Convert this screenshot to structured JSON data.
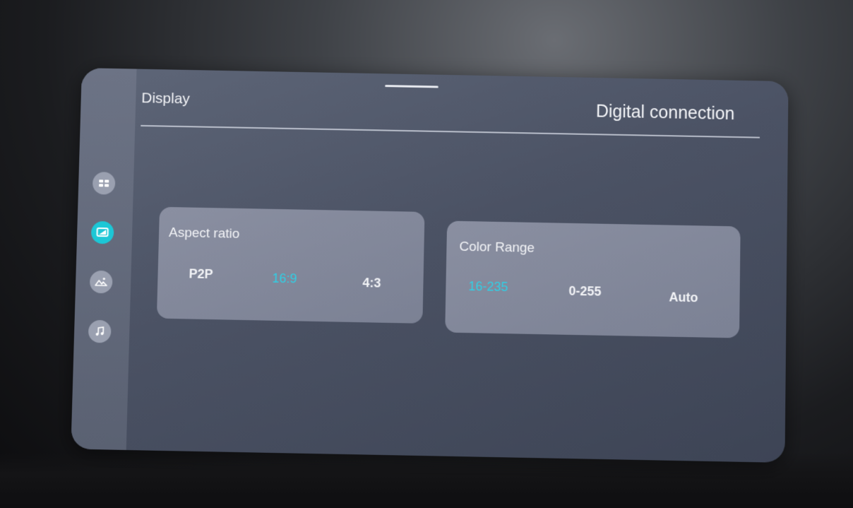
{
  "header": {
    "title": "Display",
    "section": "Digital connection"
  },
  "sidebar": {
    "items": [
      {
        "icon": "apps-grid-icon",
        "active": false
      },
      {
        "icon": "display-icon",
        "active": true
      },
      {
        "icon": "picture-icon",
        "active": false
      },
      {
        "icon": "music-note-icon",
        "active": false
      }
    ]
  },
  "aspect_ratio": {
    "label": "Aspect ratio",
    "options": [
      "P2P",
      "16:9",
      "4:3"
    ],
    "selected": "16:9"
  },
  "color_range": {
    "label": "Color Range",
    "options": [
      "16-235",
      "0-255",
      "Auto"
    ],
    "selected": "16-235"
  },
  "colors": {
    "accent": "#2fd0e6",
    "panel": "#4b5264",
    "card": "#8a8fa1"
  }
}
